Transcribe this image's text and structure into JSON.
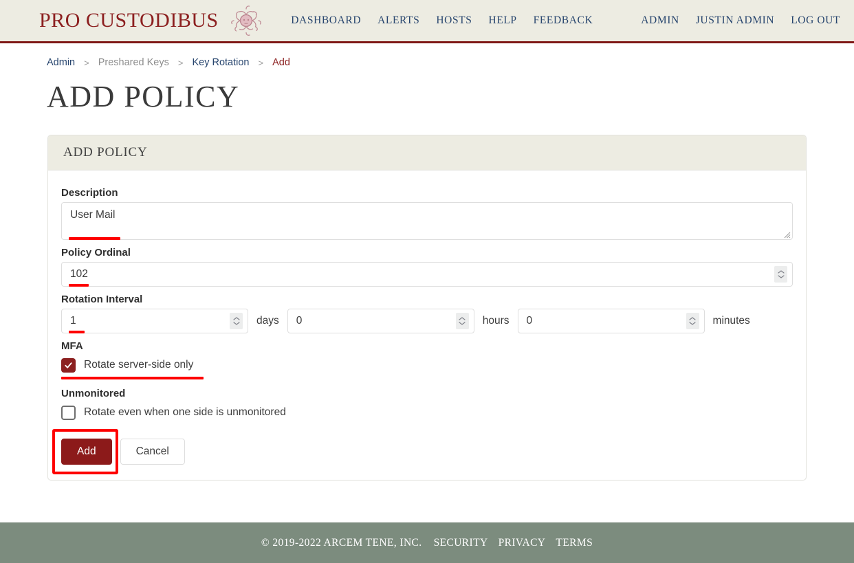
{
  "header": {
    "brand_text": "PRO CUSTODIBUS",
    "logo_icon": "medusa-head-icon",
    "nav_primary": [
      {
        "label": "DASHBOARD"
      },
      {
        "label": "ALERTS"
      },
      {
        "label": "HOSTS"
      },
      {
        "label": "HELP"
      },
      {
        "label": "FEEDBACK"
      }
    ],
    "nav_secondary": [
      {
        "label": "ADMIN"
      },
      {
        "label": "JUSTIN ADMIN"
      },
      {
        "label": "LOG OUT"
      }
    ]
  },
  "breadcrumb": {
    "separator": ">",
    "items": [
      {
        "label": "Admin",
        "kind": "link"
      },
      {
        "label": "Preshared Keys",
        "kind": "muted"
      },
      {
        "label": "Key Rotation",
        "kind": "link"
      },
      {
        "label": "Add",
        "kind": "current"
      }
    ]
  },
  "page": {
    "title": "ADD POLICY"
  },
  "card": {
    "title": "ADD POLICY",
    "description": {
      "label": "Description",
      "value": "User Mail",
      "placeholder": ""
    },
    "policy_ordinal": {
      "label": "Policy Ordinal",
      "value": "102",
      "placeholder": ""
    },
    "rotation_interval": {
      "label": "Rotation Interval",
      "days": {
        "value": "1",
        "unit": "days"
      },
      "hours": {
        "value": "0",
        "unit": "hours"
      },
      "minutes": {
        "value": "0",
        "unit": "minutes"
      }
    },
    "mfa": {
      "label": "MFA",
      "checkbox_label": "Rotate server-side only",
      "checked": true
    },
    "unmonitored": {
      "label": "Unmonitored",
      "checkbox_label": "Rotate even when one side is unmonitored",
      "checked": false
    },
    "actions": {
      "submit_label": "Add",
      "cancel_label": "Cancel"
    }
  },
  "footer": {
    "copyright": "© 2019-2022 ARCEM TENE, INC.",
    "links": [
      {
        "label": "SECURITY"
      },
      {
        "label": "PRIVACY"
      },
      {
        "label": "TERMS"
      }
    ]
  },
  "colors": {
    "brand_red": "#8c2020",
    "header_bg": "#edece2",
    "nav_blue": "#27456e",
    "footer_bg": "#7c8c7e",
    "annotation_red": "#fe0000",
    "button_primary": "#8c1a1a"
  }
}
